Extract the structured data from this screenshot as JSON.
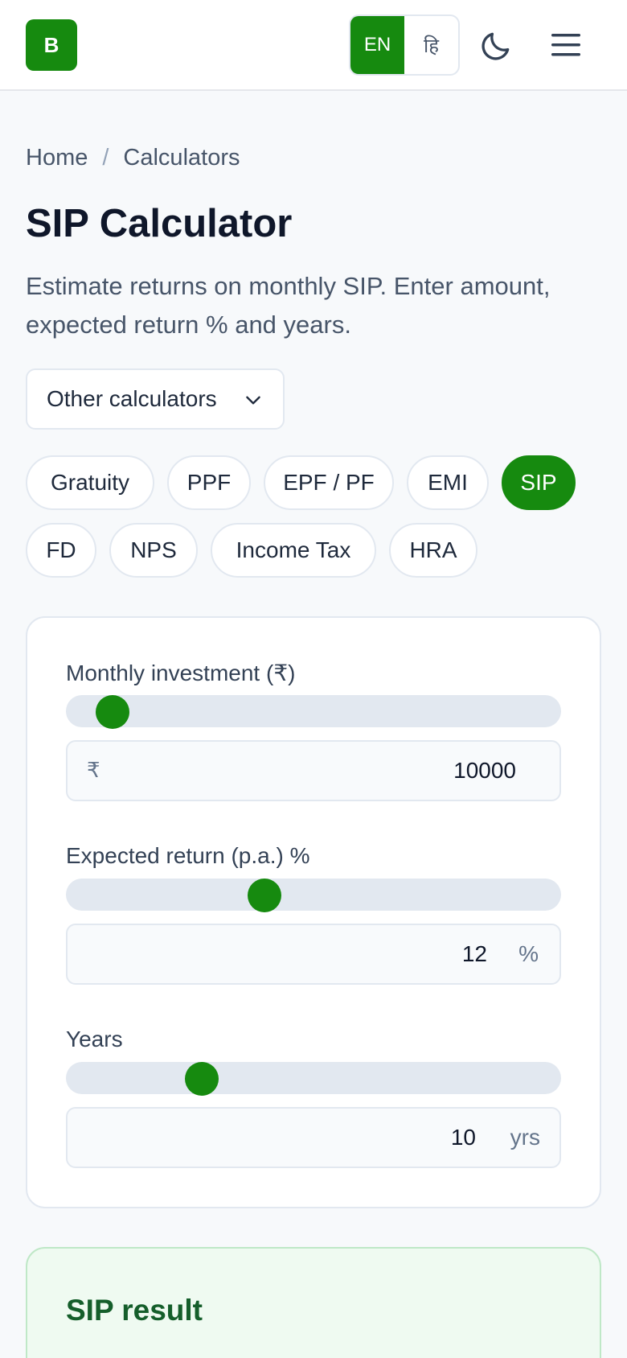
{
  "header": {
    "logo_letter": "B",
    "lang_en": "EN",
    "lang_hi": "हि",
    "theme_icon": "moon-icon",
    "menu_icon": "hamburger-menu-icon"
  },
  "breadcrumb": {
    "home": "Home",
    "separator": "/",
    "current": "Calculators"
  },
  "page": {
    "title": "SIP Calculator",
    "description": "Estimate returns on monthly SIP. Enter amount, expected return % and years."
  },
  "other_calculators": {
    "label": "Other calculators"
  },
  "calculator_pills": [
    {
      "label": "Gratuity",
      "active": false
    },
    {
      "label": "PPF",
      "active": false
    },
    {
      "label": "EPF / PF",
      "active": false
    },
    {
      "label": "EMI",
      "active": false
    },
    {
      "label": "SIP",
      "active": true
    },
    {
      "label": "FD",
      "active": false
    },
    {
      "label": "NPS",
      "active": false
    },
    {
      "label": "Income Tax",
      "active": false
    },
    {
      "label": "HRA",
      "active": false
    }
  ],
  "form": {
    "monthly": {
      "label": "Monthly investment (₹)",
      "prefix": "₹",
      "value": "10000",
      "slider_level": 0.05
    },
    "return": {
      "label": "Expected return (p.a.) %",
      "value": "12",
      "suffix": "%",
      "slider_level": 0.39
    },
    "years": {
      "label": "Years",
      "value": "10",
      "suffix": "yrs",
      "slider_level": 0.25
    }
  },
  "result": {
    "title": "SIP result"
  },
  "colors": {
    "accent": "#168a0f",
    "page_bg": "#f7f9fb",
    "result_bg": "#effaf1"
  }
}
